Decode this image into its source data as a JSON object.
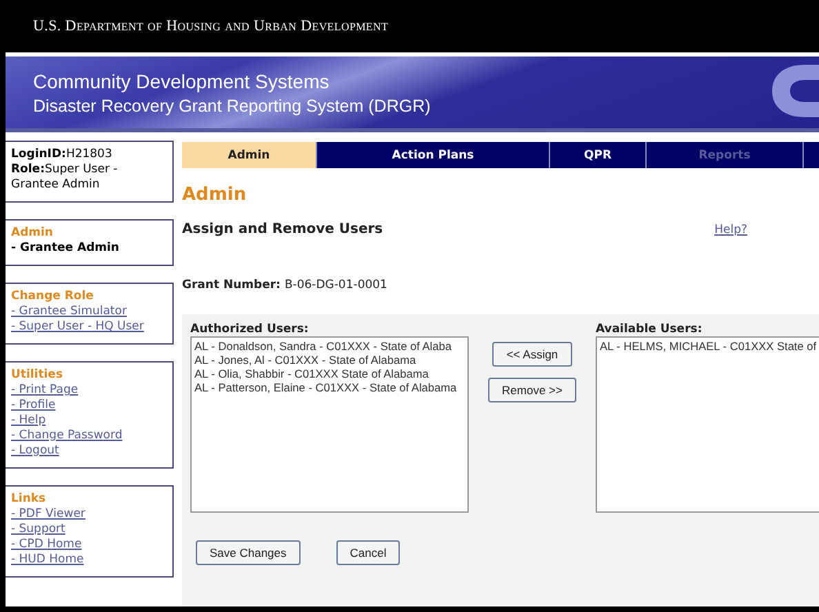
{
  "header": {
    "agency": "U.S. Department of Housing and Urban Development"
  },
  "banner": {
    "title": "Community Development Systems",
    "subtitle": "Disaster Recovery Grant Reporting System (DRGR)"
  },
  "sidebar": {
    "login": {
      "id_label": "LoginID:",
      "id_value": "H21803",
      "role_label": "Role:",
      "role_value": "Super User - Grantee Admin"
    },
    "sections": [
      {
        "title": "Admin",
        "items": [
          {
            "label": "- Grantee Admin",
            "kind": "current"
          }
        ]
      },
      {
        "title": "Change Role",
        "items": [
          {
            "label": "- Grantee Simulator",
            "kind": "link"
          },
          {
            "label": "- Super User - HQ User",
            "kind": "link"
          }
        ]
      },
      {
        "title": "Utilities",
        "items": [
          {
            "label": "- Print Page",
            "kind": "link"
          },
          {
            "label": "- Profile",
            "kind": "link"
          },
          {
            "label": "- Help",
            "kind": "link"
          },
          {
            "label": "- Change Password",
            "kind": "link"
          },
          {
            "label": "- Logout",
            "kind": "link"
          }
        ]
      },
      {
        "title": "Links",
        "items": [
          {
            "label": "- PDF Viewer",
            "kind": "link"
          },
          {
            "label": "- Support",
            "kind": "link"
          },
          {
            "label": "- CPD Home",
            "kind": "link"
          },
          {
            "label": "- HUD Home",
            "kind": "link"
          }
        ]
      }
    ]
  },
  "tabs": [
    {
      "label": "Admin",
      "selected": true,
      "disabled": false
    },
    {
      "label": "Action Plans",
      "selected": false,
      "disabled": false
    },
    {
      "label": "QPR",
      "selected": false,
      "disabled": false
    },
    {
      "label": "Reports",
      "selected": false,
      "disabled": true
    }
  ],
  "page_title": "Admin",
  "section_title": "Assign and Remove Users",
  "help_link": "Help?",
  "grant": {
    "label": "Grant Number:",
    "value": "B-06-DG-01-0001"
  },
  "authorized": {
    "label": "Authorized Users:",
    "items": [
      "AL - Donaldson, Sandra - C01XXX - State of Alaba",
      "AL - Jones, Al - C01XXX - State of Alabama",
      "AL - Olia, Shabbir - C01XXX  State of Alabama",
      "AL - Patterson, Elaine - C01XXX - State of Alabama"
    ]
  },
  "available": {
    "label": "Available Users:",
    "items": [
      "AL - HELMS, MICHAEL - C01XXX  State of"
    ]
  },
  "move_buttons": [
    "<< Assign",
    "Remove >>"
  ],
  "form_buttons": [
    "Save Changes",
    "Cancel"
  ]
}
